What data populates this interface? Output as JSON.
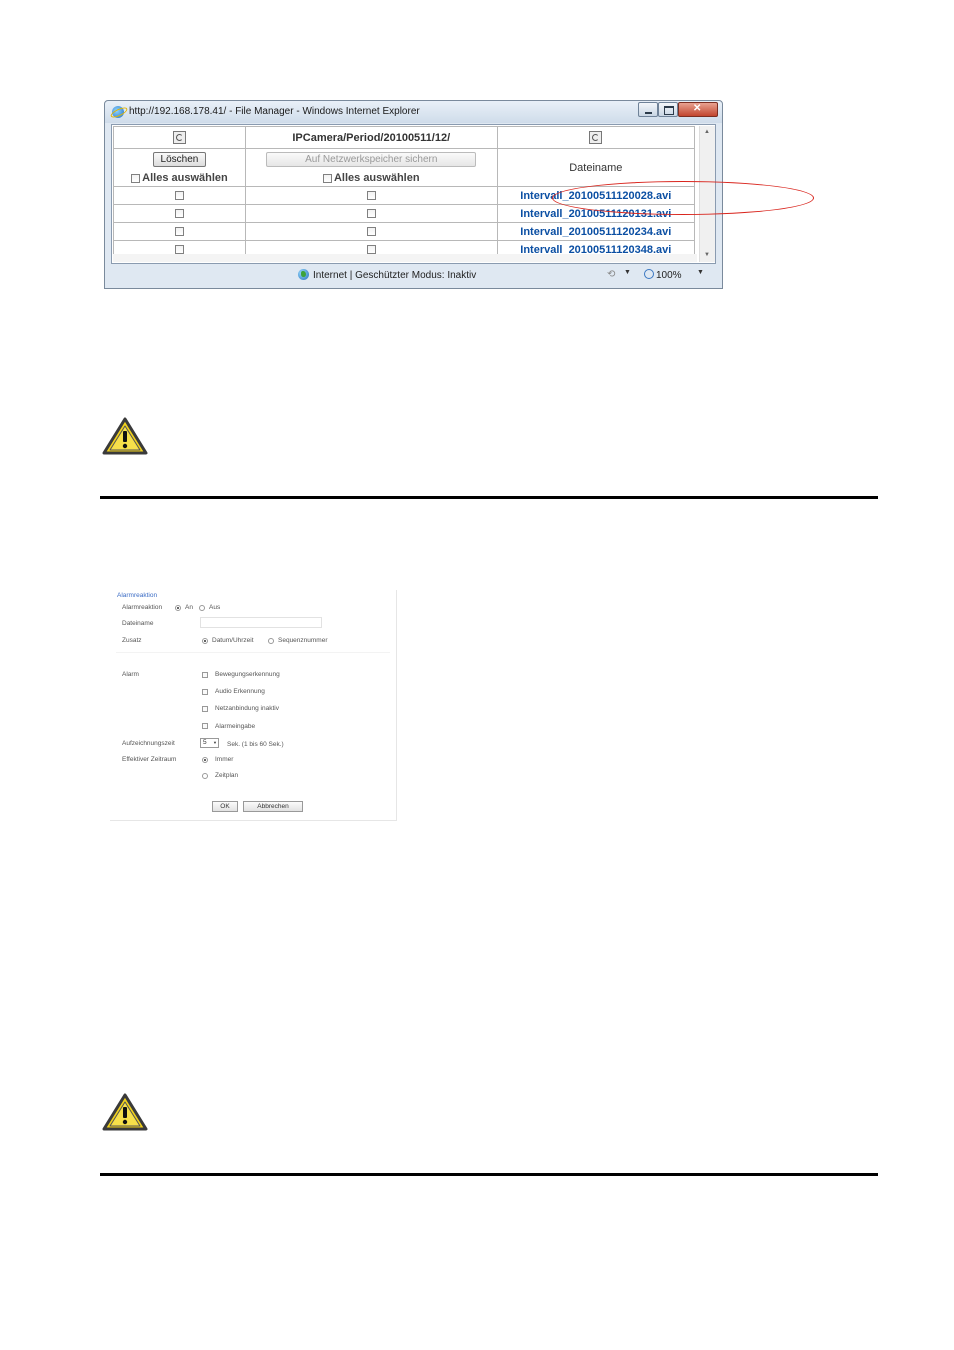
{
  "ie_window": {
    "title": "http://192.168.178.41/ - File Manager - Windows Internet Explorer"
  },
  "file_manager": {
    "path": "IPCamera/Period/20100511/12/",
    "delete_label": "Löschen",
    "nas_save_label": "Auf Netzwerkspeicher sichern",
    "select_all_label": "Alles auswählen",
    "filename_header": "Dateiname",
    "files": [
      "Intervall_20100511120028.avi",
      "Intervall_20100511120131.avi",
      "Intervall_20100511120234.avi",
      "Intervall_20100511120348.avi"
    ]
  },
  "ie_status": {
    "zone_text": "Internet | Geschützter Modus: Inaktiv",
    "zoom": "100%"
  },
  "alarm_reaction": {
    "title": "Alarmreaktion",
    "alarm_reaction_label": "Alarmreaktion",
    "on_label": "An",
    "off_label": "Aus",
    "filename_label": "Dateiname",
    "suffix_label": "Zusatz",
    "datetime_label": "Datum/Uhrzeit",
    "sequence_label": "Sequenznummer",
    "alarm_label": "Alarm",
    "motion_label": "Bewegungserkennung",
    "audio_label": "Audio Erkennung",
    "network_label": "Netzanbindung inaktiv",
    "alarm_input_label": "Alarmeingabe",
    "record_time_label": "Aufzeichnungszeit",
    "record_time_value": "5",
    "record_time_unit": "Sek. (1 bis 60 Sek.)",
    "period_label": "Effektiver Zeitraum",
    "always_label": "Immer",
    "schedule_label": "Zeitplan",
    "ok_label": "OK",
    "cancel_label": "Abbrechen"
  }
}
